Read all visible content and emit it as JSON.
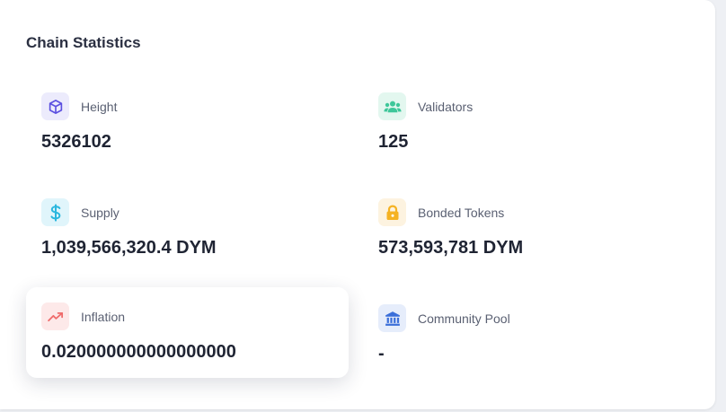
{
  "card": {
    "title": "Chain Statistics"
  },
  "stats": {
    "height": {
      "label": "Height",
      "value": "5326102",
      "icon": "cube-icon",
      "color": "#5b4fe0",
      "bg": "#ecebfc"
    },
    "validators": {
      "label": "Validators",
      "value": "125",
      "icon": "users-icon",
      "color": "#3fc79a",
      "bg": "#e3f7ef"
    },
    "supply": {
      "label": "Supply",
      "value": "1,039,566,320.4 DYM",
      "icon": "dollar-icon",
      "color": "#2bb7de",
      "bg": "#e0f5fb"
    },
    "bonded": {
      "label": "Bonded Tokens",
      "value": "573,593,781 DYM",
      "icon": "lock-icon",
      "color": "#f5b223",
      "bg": "#fdf3e0"
    },
    "inflation": {
      "label": "Inflation",
      "value": "0.020000000000000000",
      "icon": "trending-up-icon",
      "color": "#ef6b6b",
      "bg": "#fde9e9"
    },
    "community_pool": {
      "label": "Community Pool",
      "value": "-",
      "icon": "bank-icon",
      "color": "#3b6fd9",
      "bg": "#e6edfb"
    }
  }
}
